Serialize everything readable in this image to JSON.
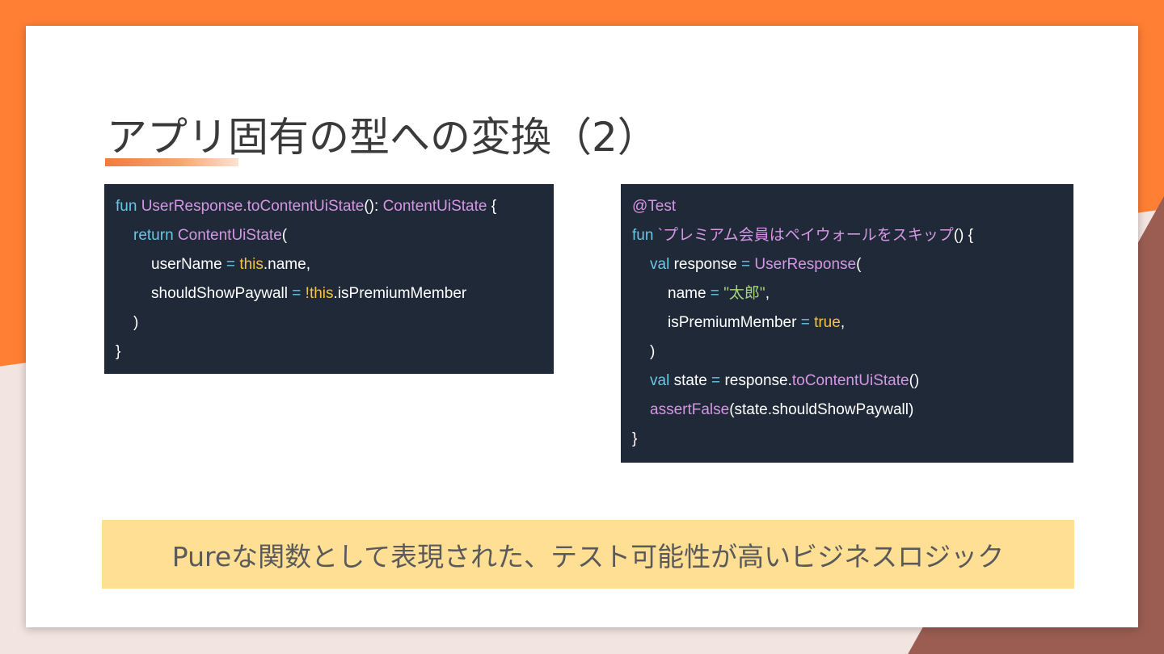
{
  "slide": {
    "title": "アプリ固有の型への変換（2）",
    "banner": "Pureな関数として表現された、テスト可能性が高いビジネスロジック"
  },
  "colors": {
    "keyword": "#67c8e6",
    "function": "#d596e4",
    "this_keyword": "#f7c141",
    "string": "#a6d47e",
    "code_bg": "#1f2937",
    "banner_bg": "#ffdf94",
    "accent": "#ff7f35"
  },
  "code_left": {
    "l1": {
      "fun": "fun",
      "name": "UserResponse.toContentUiState",
      "sig": "(): ",
      "type": "ContentUiState",
      "brace": " {"
    },
    "l2": {
      "return": "return",
      "call": " ContentUiState",
      "paren": "("
    },
    "l3": {
      "prop": "userName",
      "eq": " = ",
      "this": "this",
      "rest": ".name,"
    },
    "l4": {
      "prop": "shouldShowPaywall",
      "eq": " = ",
      "not": "!",
      "this": "this",
      "rest": ".isPremiumMember"
    },
    "l5": ")",
    "l6": "}"
  },
  "code_right": {
    "l1": "@Test",
    "l2": {
      "fun": "fun",
      "name": " `プレミアム会員はペイウォールをスキップ",
      "rest": "() {"
    },
    "l3": {
      "val": "val",
      "var": " response",
      "eq": " = ",
      "call": "UserResponse",
      "paren": "("
    },
    "l4": {
      "prop": "name",
      "eq": " = ",
      "str": "\"太郎\"",
      "comma": ","
    },
    "l5": {
      "prop": "isPremiumMember",
      "eq": " = ",
      "bool": "true",
      "comma": ","
    },
    "l6": ")",
    "l7": {
      "val": "val",
      "var": " state",
      "eq": " = ",
      "obj": "response.",
      "call": "toContentUiState",
      "rest": "()"
    },
    "l8": {
      "call": "assertFalse",
      "rest": "(state.shouldShowPaywall)"
    },
    "l9": "}"
  }
}
